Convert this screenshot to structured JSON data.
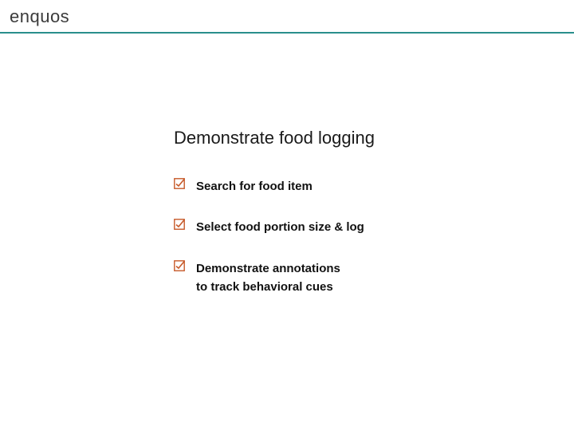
{
  "brand": "enquos",
  "accent": "#c75a2a",
  "title": "Demonstrate food logging",
  "items": [
    {
      "text": "Search for food item"
    },
    {
      "text": "Select food portion size & log"
    },
    {
      "text": "Demonstrate annotations\nto track behavioral cues"
    }
  ]
}
